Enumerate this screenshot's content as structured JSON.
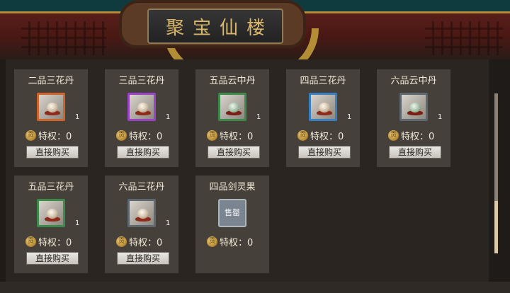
{
  "title": "聚宝仙楼",
  "cards": [
    {
      "name": "二品三花丹",
      "count": "1",
      "privilege": "特权：0",
      "button": "直接购买",
      "coin": "贡",
      "frame_color": "#d0642a"
    },
    {
      "name": "三品三花丹",
      "count": "1",
      "privilege": "特权：0",
      "button": "直接购买",
      "coin": "贡",
      "frame_color": "#9a43c9"
    },
    {
      "name": "五品云中丹",
      "count": "1",
      "privilege": "特权：0",
      "button": "直接购买",
      "coin": "贡",
      "frame_color": "#3d8a4a"
    },
    {
      "name": "四品三花丹",
      "count": "1",
      "privilege": "特权：0",
      "button": "直接购买",
      "coin": "贡",
      "frame_color": "#3a7fc2"
    },
    {
      "name": "六品云中丹",
      "count": "1",
      "privilege": "特权：0",
      "button": "直接购买",
      "coin": "贡",
      "frame_color": "#5f6770"
    },
    {
      "name": "五品三花丹",
      "count": "1",
      "privilege": "特权：0",
      "button": "直接购买",
      "coin": "贡",
      "frame_color": "#3d8a4a"
    },
    {
      "name": "六品三花丹",
      "count": "1",
      "privilege": "特权：0",
      "button": "直接购买",
      "coin": "贡",
      "frame_color": "#5f6770"
    },
    {
      "name": "四品剑灵果",
      "soldout": "售罄",
      "privilege": "特权：0",
      "coin": "贡"
    }
  ],
  "colors": {
    "accent_gold": "#d9b66a",
    "panel_bg": "#2a2520",
    "card_bg": "#45403a"
  }
}
